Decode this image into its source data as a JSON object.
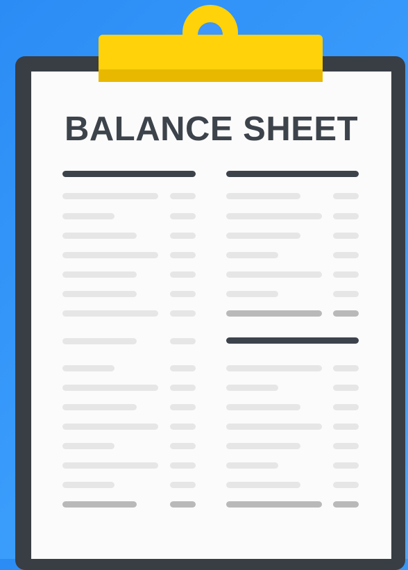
{
  "document": {
    "title": "BALANCE SHEET",
    "colors": {
      "background": "#2b8cf5",
      "clipboard": "#393d44",
      "clip": "#ffd20a",
      "paper": "#fbfbfb",
      "heading_bar": "#3d434b",
      "line": "#e6e6e6",
      "total_line": "#b9b9b9"
    },
    "icons": [
      "clipboard-icon",
      "clip-icon"
    ]
  }
}
